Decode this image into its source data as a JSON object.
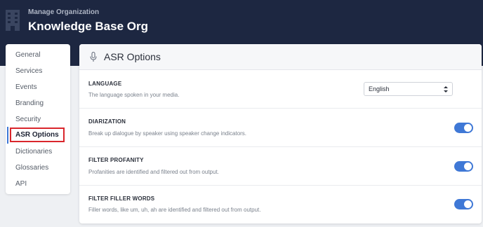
{
  "header": {
    "subtitle": "Manage Organization",
    "title": "Knowledge Base Org",
    "icon": "building-icon"
  },
  "sidebar": {
    "items": [
      {
        "label": "General",
        "active": false
      },
      {
        "label": "Services",
        "active": false
      },
      {
        "label": "Events",
        "active": false
      },
      {
        "label": "Branding",
        "active": false
      },
      {
        "label": "Security",
        "active": false
      },
      {
        "label": "ASR Options",
        "active": true
      },
      {
        "label": "Dictionaries",
        "active": false
      },
      {
        "label": "Glossaries",
        "active": false
      },
      {
        "label": "API",
        "active": false
      }
    ]
  },
  "panel": {
    "title": "ASR Options",
    "icon": "microphone-icon",
    "settings": [
      {
        "title": "LANGUAGE",
        "description": "The language spoken in your media.",
        "control": "select",
        "value": "English"
      },
      {
        "title": "DIARIZATION",
        "description": "Break up dialogue by speaker using speaker change indicators.",
        "control": "toggle",
        "enabled": true
      },
      {
        "title": "FILTER PROFANITY",
        "description": "Profanities are identified and filtered out from output.",
        "control": "toggle",
        "enabled": true
      },
      {
        "title": "FILTER FILLER WORDS",
        "description": "Filler words, like um, uh, ah are identified and filtered out from output.",
        "control": "toggle",
        "enabled": true
      }
    ]
  },
  "colors": {
    "header_bg": "#1d2741",
    "accent": "#3f78d6",
    "highlight_box": "#d9262c",
    "page_bg": "#eef0f3"
  }
}
